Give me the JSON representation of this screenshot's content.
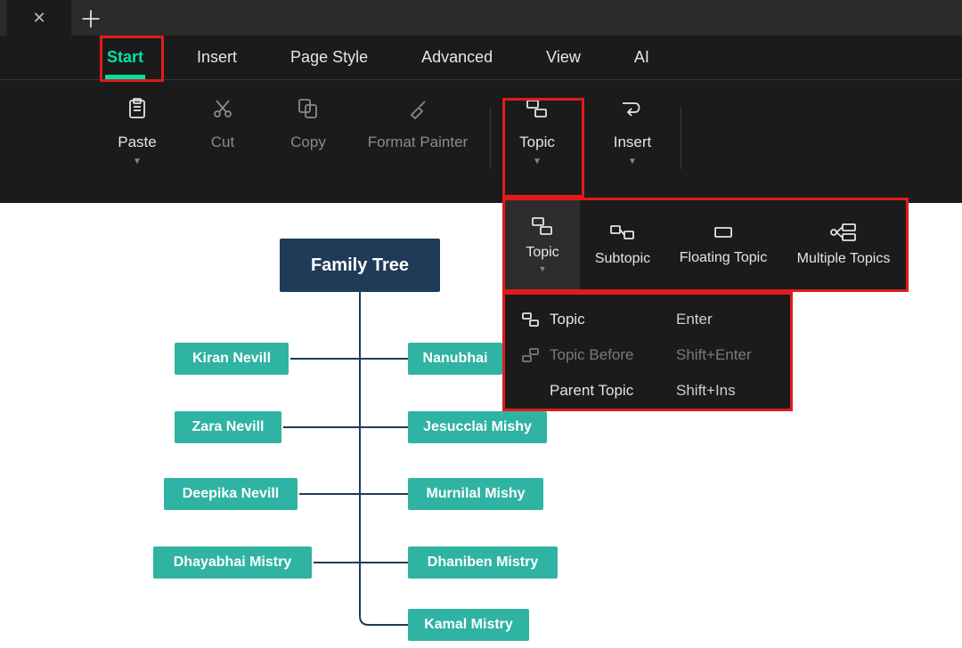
{
  "menu": {
    "start": "Start",
    "insert": "Insert",
    "page_style": "Page Style",
    "advanced": "Advanced",
    "view": "View",
    "ai": "AI"
  },
  "toolbar": {
    "paste": "Paste",
    "cut": "Cut",
    "copy": "Copy",
    "format_painter": "Format Painter",
    "topic": "Topic",
    "insert": "Insert"
  },
  "topic_panel": {
    "topic": "Topic",
    "subtopic": "Subtopic",
    "floating": "Floating Topic",
    "multiple": "Multiple Topics"
  },
  "topic_submenu": {
    "topic": {
      "label": "Topic",
      "shortcut": "Enter"
    },
    "topic_before": {
      "label": "Topic Before",
      "shortcut": "Shift+Enter"
    },
    "parent_topic": {
      "label": "Parent Topic",
      "shortcut": "Shift+Ins"
    }
  },
  "tree": {
    "root": "Family Tree",
    "left": [
      "Kiran Nevill",
      "Zara Nevill",
      "Deepika Nevill",
      "Dhayabhai Mistry"
    ],
    "right": [
      "Nanubhai",
      "Jesucclai Mishy",
      "Murnilal Mishy",
      "Dhaniben Mistry",
      "Kamal Mistry"
    ]
  },
  "colors": {
    "accent": "#00e3a0",
    "highlight": "#e11b1b",
    "node": "#2fb3a3",
    "root": "#1f3b57"
  }
}
